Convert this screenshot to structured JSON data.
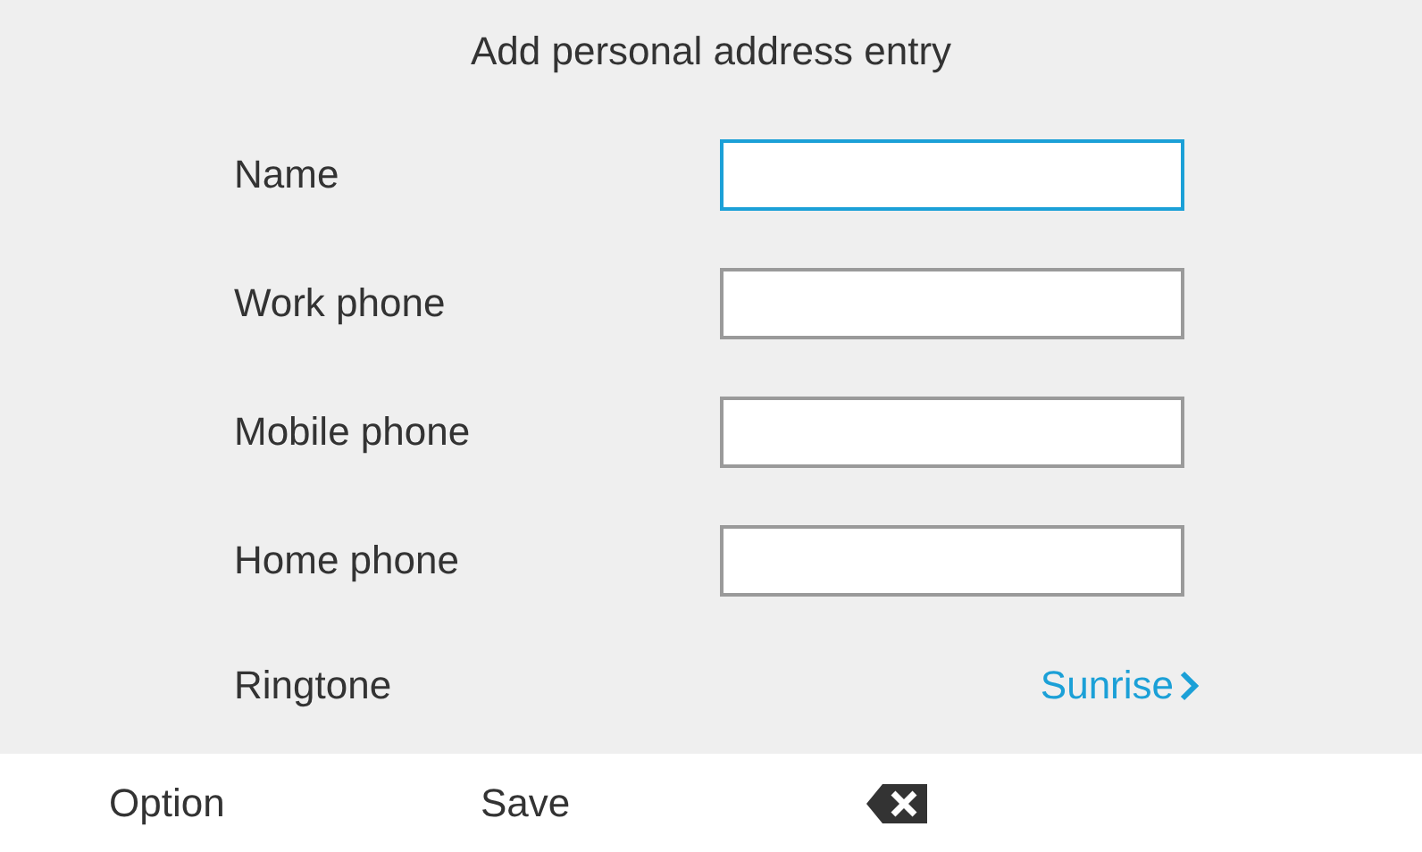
{
  "title": "Add personal address entry",
  "fields": [
    {
      "label": "Name",
      "focused": true
    },
    {
      "label": "Work phone",
      "focused": false
    },
    {
      "label": "Mobile phone",
      "focused": false
    },
    {
      "label": "Home phone",
      "focused": false
    }
  ],
  "ringtone": {
    "label": "Ringtone",
    "value": "Sunrise"
  },
  "softkeys": [
    {
      "kind": "text",
      "label": "Option"
    },
    {
      "kind": "text",
      "label": "Save"
    },
    {
      "kind": "backspace"
    }
  ]
}
